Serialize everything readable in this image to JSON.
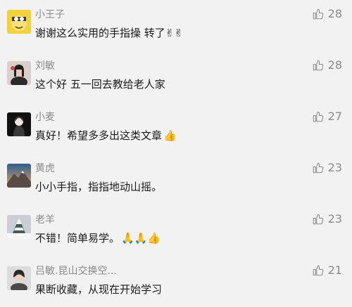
{
  "comments": [
    {
      "name": "小王子",
      "text": "谢谢这么实用的手指操 转了✌✌",
      "likes": "28",
      "avatar": "cartoon-character"
    },
    {
      "name": "刘敏",
      "text": "这个好 五一回去教给老人家",
      "likes": "28",
      "avatar": "portrait-photo"
    },
    {
      "name": "小麦",
      "text": "真好！希望多多出这类文章",
      "emoji": "👍",
      "likes": "27",
      "avatar": "silhouette-photo"
    },
    {
      "name": "黄虎",
      "text": "小小手指，指指地动山摇。",
      "likes": "23",
      "avatar": "mountain-photo"
    },
    {
      "name": "老羊",
      "text": "不错！简单易学。",
      "emoji": "🙏🙏👍",
      "likes": "23",
      "avatar": "snowy-tree-photo"
    },
    {
      "name": "吕敏.昆山交换空...",
      "text": "果断收藏，从现在开始学习",
      "likes": "21",
      "avatar": "woman-photo"
    }
  ],
  "colors": {
    "background": "#f2f2f2",
    "name": "#8a8a8a",
    "text": "#1b1b1b",
    "like": "#8a8a8a"
  },
  "icons": {
    "like": "thumbs-up-outline-icon"
  }
}
